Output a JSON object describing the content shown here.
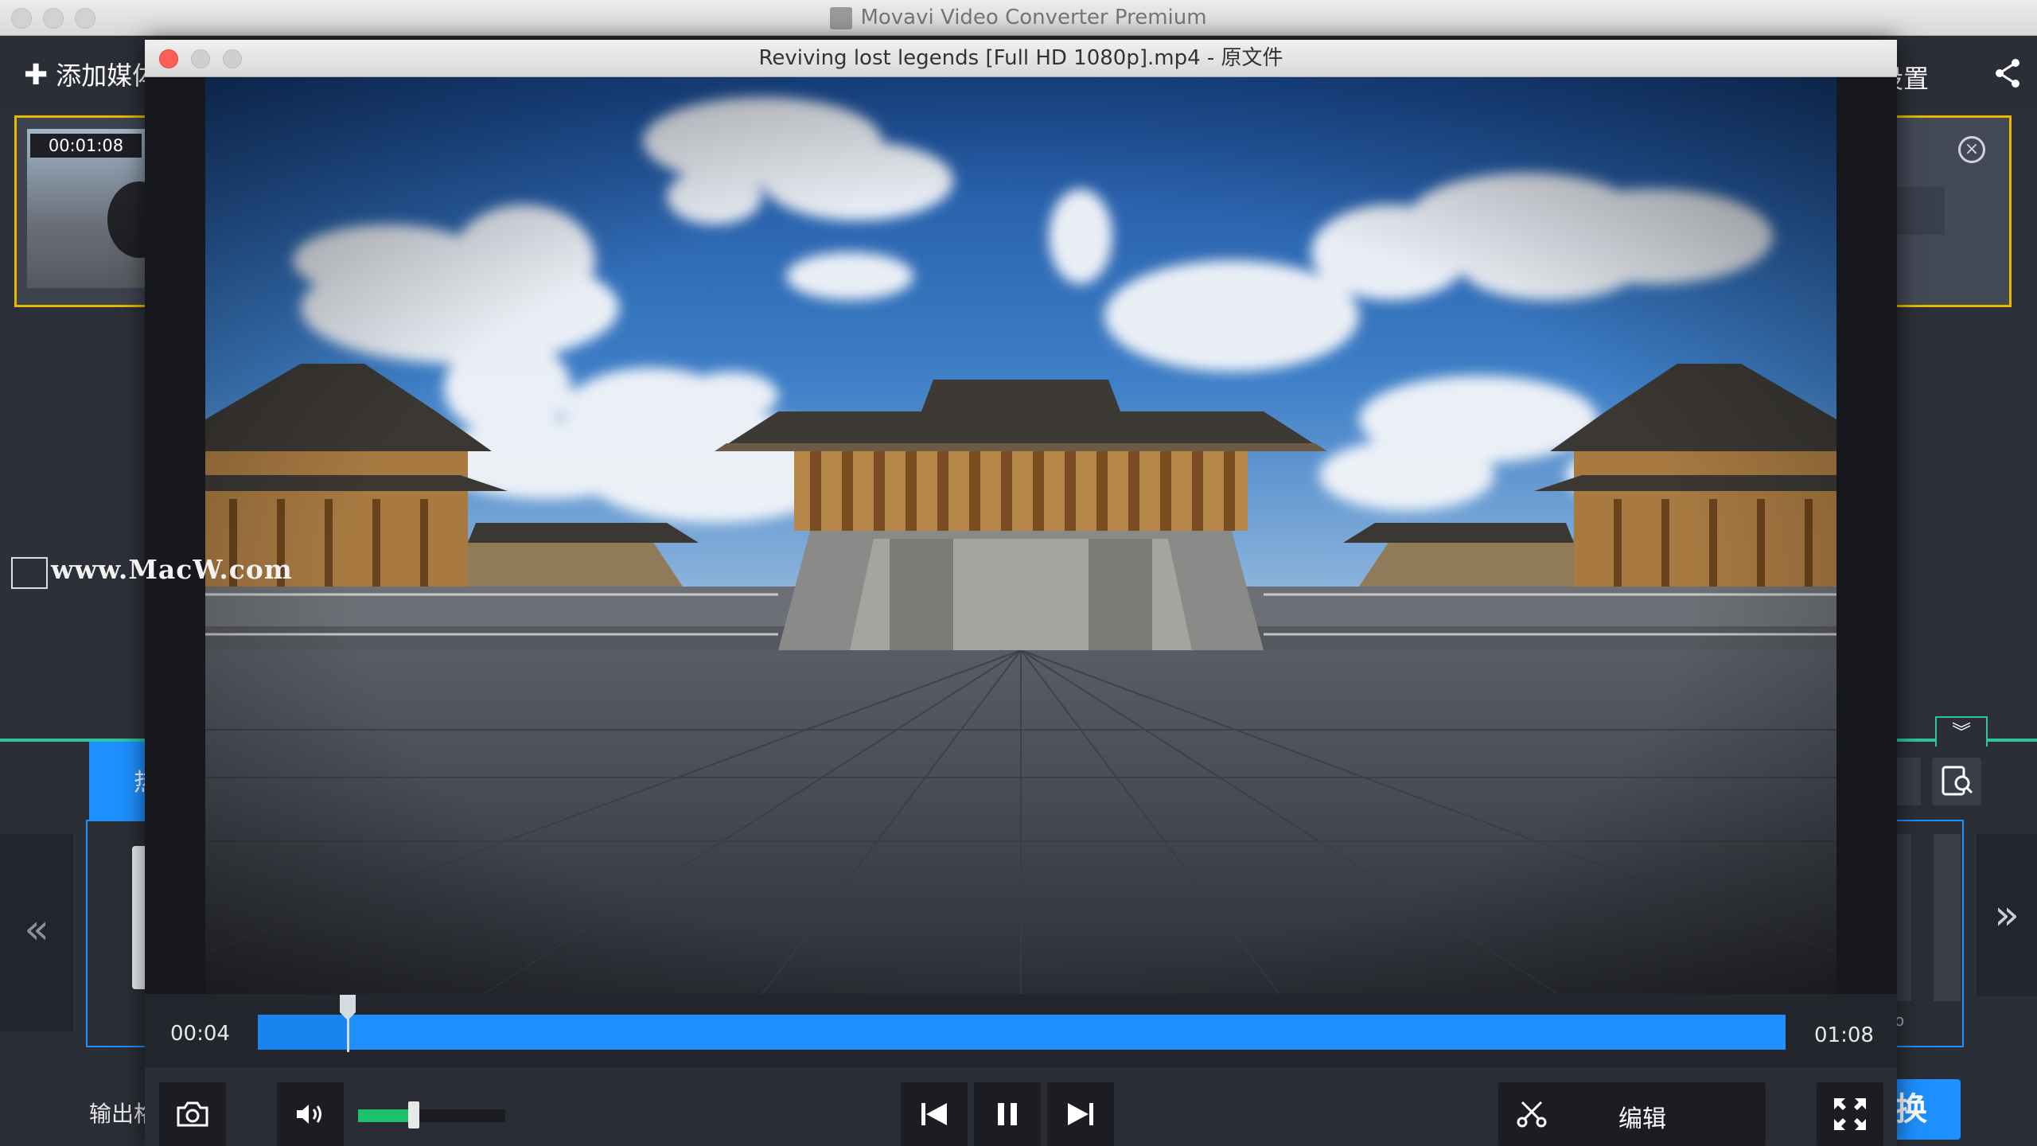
{
  "app": {
    "title": "Movavi Video Converter Premium",
    "add_media_label": "添加媒体",
    "settings_label": "设置",
    "file_card": {
      "duration": "00:01:08"
    },
    "output_label": "输出格式",
    "tab_label": "热门",
    "convert_label": "换",
    "right_panel_text": "o",
    "watermark": "www.MacW.com"
  },
  "preview": {
    "title": "Reviving lost legends [Full HD 1080p].mp4 - 原文件",
    "current_time": "00:04",
    "total_time": "01:08",
    "progress_fraction": 0.059,
    "volume_fraction": 0.38,
    "edit_label": "编辑"
  },
  "colors": {
    "accent_blue": "#1e90ff",
    "teal": "#2ec4a0",
    "highlight_yellow": "#e6b800",
    "volume_green": "#1fc16b",
    "close_red": "#ff5f57"
  },
  "icons": {
    "snapshot": "camera-icon",
    "volume": "speaker-icon",
    "previous": "skip-back-icon",
    "pause": "pause-icon",
    "next": "skip-forward-icon",
    "edit": "scissors-icon",
    "fullscreen": "fullscreen-icon",
    "share": "share-icon",
    "search": "search-device-icon"
  }
}
